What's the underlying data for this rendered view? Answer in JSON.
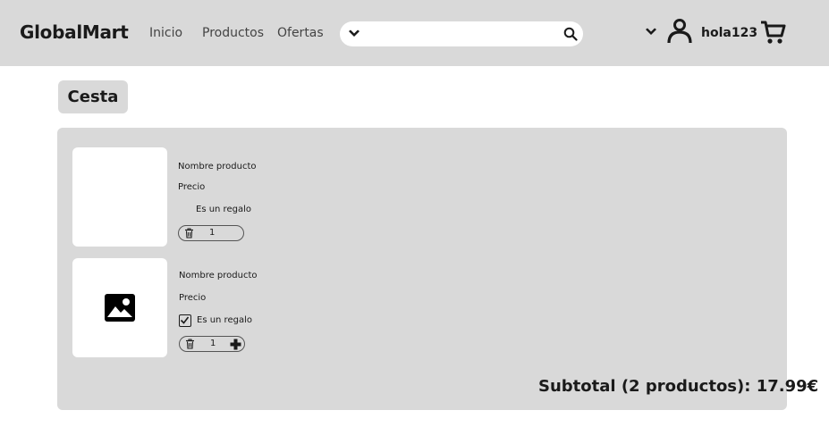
{
  "header": {
    "logo": "GlobalMart",
    "nav": [
      {
        "label": "Inicio"
      },
      {
        "label": "Productos"
      },
      {
        "label": "Ofertas"
      }
    ],
    "search": {
      "value": "",
      "placeholder": ""
    },
    "username": "hola123"
  },
  "basket": {
    "title": "Cesta",
    "items": [
      {
        "name": "Nombre producto",
        "price": "Precio",
        "gift_label": "Es un regalo",
        "gift_checked": false,
        "quantity": "1",
        "has_image": false
      },
      {
        "name": "Nombre producto",
        "price": "Precio",
        "gift_label": "Es un regalo",
        "gift_checked": true,
        "quantity": "1",
        "has_image": true
      }
    ],
    "subtotal": "Subtotal (2 productos): 17.99€"
  },
  "icons": {
    "search": "search-icon",
    "dropdown": "chevron-down-icon",
    "user": "user-icon",
    "cart": "cart-icon",
    "image": "image-placeholder-icon",
    "trash": "trash-icon",
    "plus": "plus-icon",
    "check": "check-icon"
  },
  "colors": {
    "header_bg": "#d9d9d9",
    "panel_bg": "#d9d9d9",
    "page_bg": "#ffffff",
    "text": "#1a1a1a"
  }
}
